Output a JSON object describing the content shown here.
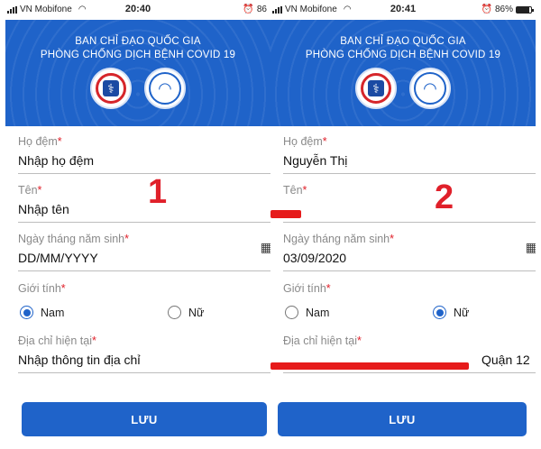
{
  "screens": [
    {
      "status": {
        "carrier": "VN Mobifone",
        "time": "20:40",
        "battery": "86",
        "battery_level": 0.86
      },
      "banner": {
        "line1": "BAN CHỈ ĐẠO QUỐC GIA",
        "line2": "PHÒNG CHỐNG DỊCH BỆNH COVID 19"
      },
      "fields": {
        "surname_label": "Họ đệm",
        "surname_value": "Nhập họ đệm",
        "name_label": "Tên",
        "name_value": "Nhập tên",
        "dob_label": "Ngày tháng năm sinh",
        "dob_value": "DD/MM/YYYY",
        "gender_label": "Giới tính",
        "gender_male": "Nam",
        "gender_female": "Nữ",
        "gender_selected": "Nam",
        "address_label": "Địa chỉ hiện tại",
        "address_value": "Nhập thông tin địa chỉ"
      },
      "save_label": "LƯU",
      "step": "1"
    },
    {
      "status": {
        "carrier": "VN Mobifone",
        "time": "20:41",
        "battery": "86%",
        "battery_level": 0.86
      },
      "banner": {
        "line1": "BAN CHỈ ĐẠO QUỐC GIA",
        "line2": "PHÒNG CHỐNG DỊCH BỆNH COVID 19"
      },
      "fields": {
        "surname_label": "Họ đệm",
        "surname_value": "Nguyễn Thị",
        "name_label": "Tên",
        "name_value": "",
        "dob_label": "Ngày tháng năm sinh",
        "dob_value": "03/09/2020",
        "gender_label": "Giới tính",
        "gender_male": "Nam",
        "gender_female": "Nữ",
        "gender_selected": "Nữ",
        "address_label": "Địa chỉ hiện tại",
        "address_value": "Quận 12"
      },
      "save_label": "LƯU",
      "step": "2"
    }
  ],
  "required_marker": "*",
  "colors": {
    "primary": "#1f63c9",
    "required": "#e0202a",
    "redaction": "#e61b1b"
  }
}
